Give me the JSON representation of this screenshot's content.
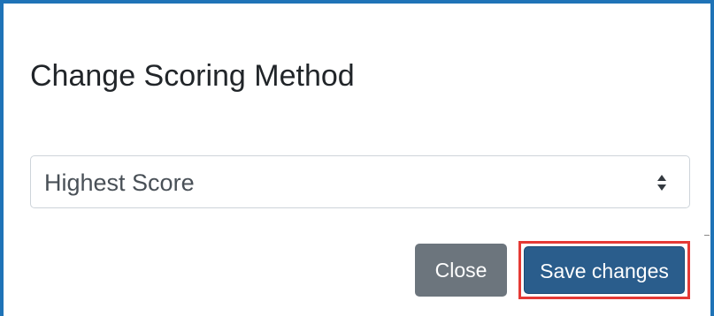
{
  "dialog": {
    "title": "Change Scoring Method",
    "scoring_select": {
      "selected_value": "Highest Score"
    },
    "buttons": {
      "close_label": "Close",
      "save_label": "Save changes"
    }
  },
  "colors": {
    "frame_border": "#1f73b7",
    "close_button": "#6c757d",
    "save_button": "#2a5d8c",
    "highlight_outline": "#e53935"
  }
}
